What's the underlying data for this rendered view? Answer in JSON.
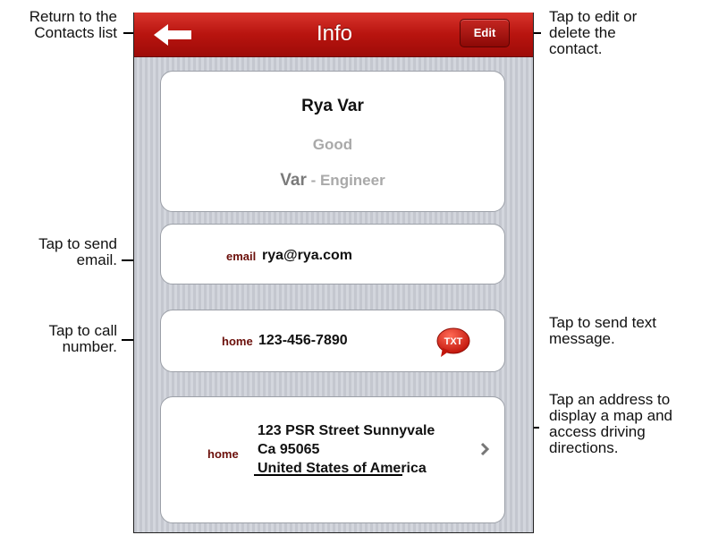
{
  "callouts": {
    "back": [
      "Return to the",
      "Contacts list"
    ],
    "edit": [
      "Tap to edit or",
      "delete the",
      "contact."
    ],
    "email": [
      "Tap to send",
      "email."
    ],
    "call": [
      "Tap to call",
      "number."
    ],
    "text": [
      "Tap to send text",
      "message."
    ],
    "address": [
      "Tap an address to",
      "display a map and",
      "access driving",
      "directions."
    ]
  },
  "titlebar": {
    "title": "Info",
    "back_icon": "back-arrow-icon",
    "edit_label": "Edit"
  },
  "contact": {
    "name": "Rya Var",
    "nickname": "Good",
    "company": "Var",
    "job_title": " - Engineer"
  },
  "email": {
    "label": "email",
    "value": "rya@rya.com"
  },
  "phone": {
    "label": "home",
    "value": "123-456-7890",
    "txt_label": "TXT"
  },
  "address": {
    "label": "home",
    "lines": [
      "123 PSR Street Sunnyvale",
      "Ca 95065",
      "United States of America"
    ]
  },
  "colors": {
    "titlebar": "#b8140f",
    "field_label": "#6b0f0a",
    "secondary_text": "#a9a9a9"
  }
}
